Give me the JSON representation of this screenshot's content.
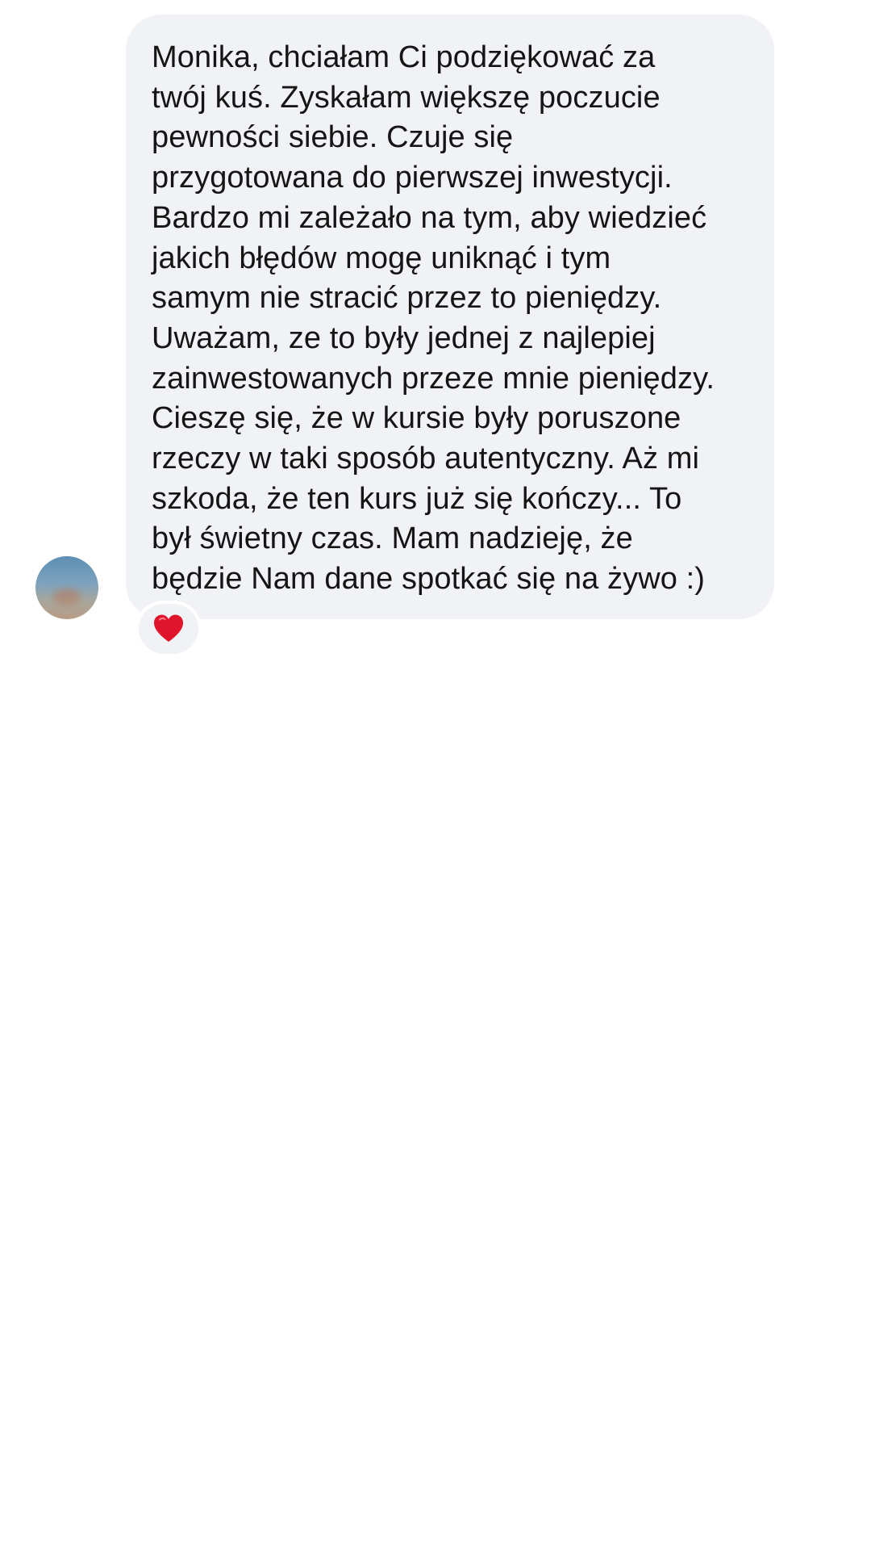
{
  "message": {
    "text": "Monika, chciałam Ci podziękować za\ntwój kuś. Zyskałam większę poczucie\npewności siebie. Czuje się\nprzygotowana do pierwszej inwestycji.\nBardzo mi zależało na tym, aby wiedzieć\njakich błędów mogę uniknąć i tym\nsamym nie stracić przez to pieniędzy.\nUważam, ze to były jednej z najlepiej\nzainwestowanych przeze mnie pieniędzy.\nCieszę się, że w kursie były poruszone\nrzeczy w taki sposób autentyczny. Aż mi\nszkoda, że ten kurs już się kończy... To\nbył świetny czas. Mam nadzieję, że\nbędzie Nam dane spotkać się na żywo :)",
    "reaction_icon": "heart-icon",
    "reaction_color": "#e0142a"
  },
  "colors": {
    "bubble_background": "#f1f2f5",
    "text": "#151515",
    "page_background": "#ffffff"
  }
}
